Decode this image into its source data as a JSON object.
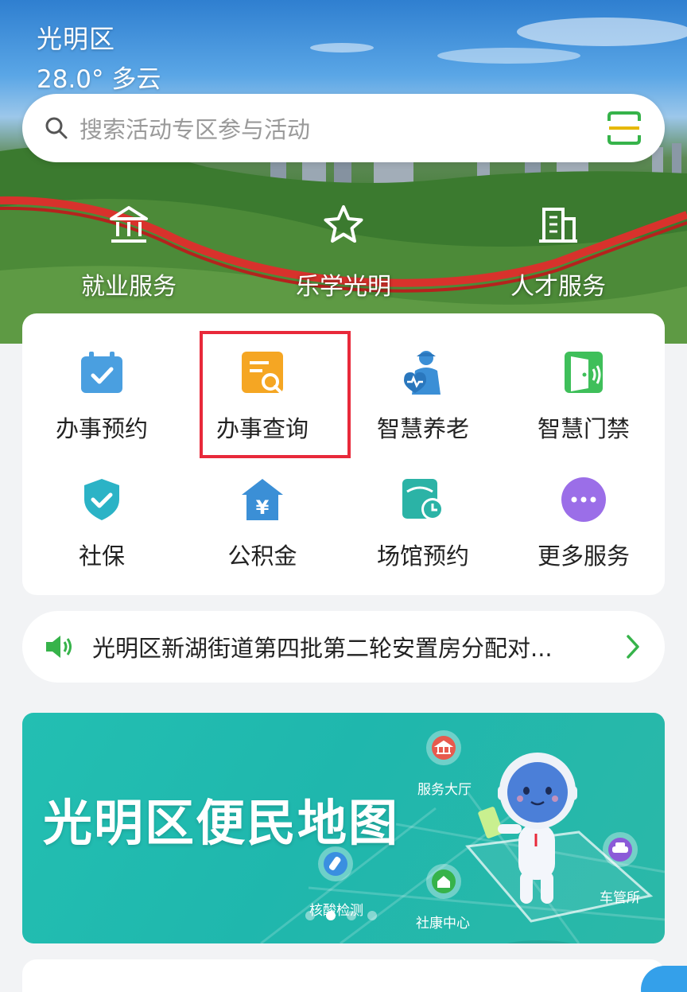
{
  "header": {
    "location": "光明区",
    "weather": "28.0° 多云"
  },
  "search": {
    "placeholder": "搜索活动专区参与活动",
    "icon": "search-icon",
    "scan_icon": "scan-icon"
  },
  "quick_links": [
    {
      "label": "就业服务",
      "icon": "bank-icon"
    },
    {
      "label": "乐学光明",
      "icon": "star-icon"
    },
    {
      "label": "人才服务",
      "icon": "building-icon"
    }
  ],
  "services": [
    {
      "label": "办事预约",
      "icon": "calendar-check-icon",
      "color": "#4a9fe0"
    },
    {
      "label": "办事查询",
      "icon": "document-search-icon",
      "color": "#f5a623"
    },
    {
      "label": "智慧养老",
      "icon": "elderly-care-icon",
      "color": "#3b8fd6"
    },
    {
      "label": "智慧门禁",
      "icon": "door-icon",
      "color": "#3fbf5a"
    },
    {
      "label": "社保",
      "icon": "shield-check-icon",
      "color": "#2bb3c6"
    },
    {
      "label": "公积金",
      "icon": "house-yuan-icon",
      "color": "#3b8fd6"
    },
    {
      "label": "场馆预约",
      "icon": "venue-clock-icon",
      "color": "#2bb3a6"
    },
    {
      "label": "更多服务",
      "icon": "more-icon",
      "color": "#9b6ee8"
    }
  ],
  "notice": {
    "text": "光明区新湖街道第四批第二轮安置房分配对...",
    "icon": "speaker-icon"
  },
  "banner": {
    "title": "光明区便民地图",
    "pins": [
      {
        "label": "服务大厅",
        "icon": "bank-icon"
      },
      {
        "label": "核酸检测",
        "icon": "test-tube-icon"
      },
      {
        "label": "社康中心",
        "icon": "clinic-icon"
      },
      {
        "label": "车管所",
        "icon": "car-icon"
      }
    ],
    "slide_count": 4,
    "active_slide": 2
  },
  "colors": {
    "accent_green": "#36b34a",
    "highlight_red": "#e8293a",
    "banner_teal": "#23bfb2"
  }
}
